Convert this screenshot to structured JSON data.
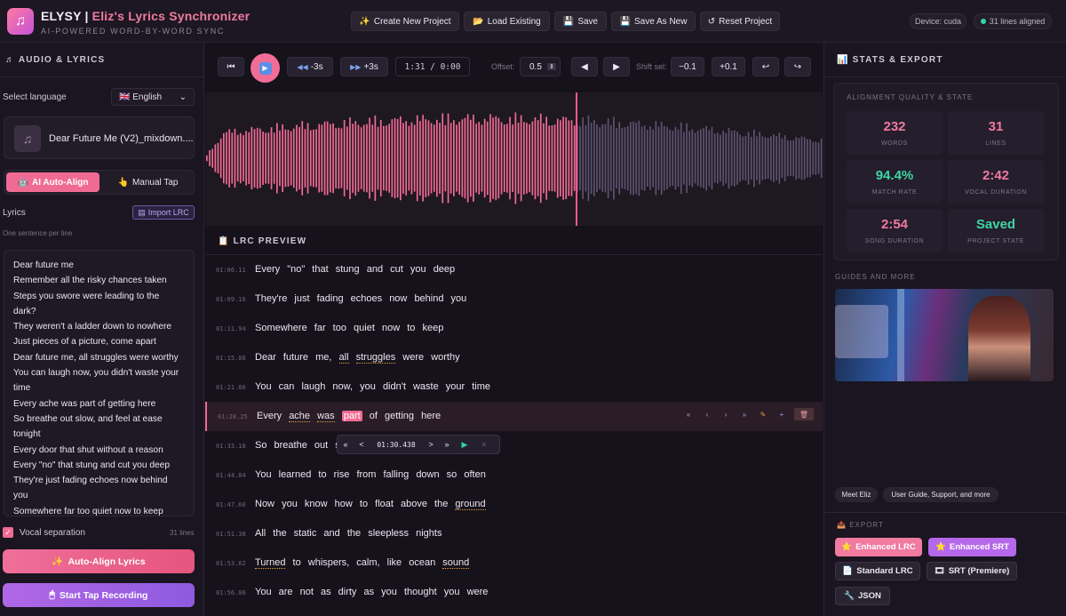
{
  "header": {
    "title": "ELYSY | Eliz's Lyrics Synchronizer",
    "subtitle": "AI-POWERED WORD-BY-WORD SYNC",
    "buttons": {
      "create": "Create New Project",
      "load": "Load Existing",
      "save": "Save",
      "save_as": "Save As New",
      "reset": "Reset Project"
    },
    "device": "Device: cuda",
    "aligned": "31 lines aligned"
  },
  "left": {
    "section_title": "AUDIO & LYRICS",
    "language_label": "Select language",
    "language_value": "🇬🇧 English",
    "file_name": "Dear Future Me (V2)_mixdown....",
    "mode_ai": "AI Auto-Align",
    "mode_manual": "Manual Tap",
    "lyrics_label": "Lyrics",
    "import_label": "Import LRC",
    "hint": "One sentence per line",
    "lyrics_lines": [
      "Dear future me",
      "Remember all the risky chances taken",
      "Steps you swore were leading to the",
      "dark?",
      "They weren't a ladder down to nowhere",
      "Just pieces of a picture, come apart",
      "Dear future me, all struggles were worthy",
      "You can laugh now, you didn't waste your",
      "time",
      "Every ache was part of getting here",
      "So breathe out slow, and feel at ease",
      "tonight",
      "Every door that shut without a reason",
      "Every \"no\" that stung and cut you deep",
      "They're just fading echoes now behind",
      "you",
      "Somewhere far too quiet now to keep"
    ],
    "vocal_sep_label": "Vocal separation",
    "line_count": "31 lines",
    "auto_align_button": "Auto-Align Lyrics",
    "tap_button": "Start Tap Recording"
  },
  "player": {
    "back_label": "-3s",
    "fwd_label": "+3s",
    "time": "1:31  /  0:00",
    "offset_label": "Offset:",
    "offset_value": "0.5",
    "shift_label": "Shift sel:",
    "minus": "−0.1",
    "plus": "+0.1"
  },
  "waveform": {
    "progress": 0.6,
    "played_color": "#f06b93",
    "remaining_color": "#5d5270"
  },
  "lrc": {
    "title": "LRC PREVIEW",
    "rows": [
      {
        "ts": "01:06.11",
        "text": "Every \"no\" that stung and cut you deep"
      },
      {
        "ts": "01:09.16",
        "text": "They're just fading echoes now behind you"
      },
      {
        "ts": "01:11.94",
        "text": "Somewhere far too quiet now to keep"
      },
      {
        "ts": "01:15.06",
        "text": "Dear future me, all struggles were worthy"
      },
      {
        "ts": "01:21.80",
        "text": "You can laugh now, you didn't waste your time"
      },
      {
        "ts": "01:28.25",
        "text": "Every ache was part of getting here"
      },
      {
        "ts": "01:33.18",
        "text": "So breathe out s"
      },
      {
        "ts": "01:44.84",
        "text": "You learned to rise from falling down so often"
      },
      {
        "ts": "01:47.60",
        "text": "Now you know how to float above the ground"
      },
      {
        "ts": "01:51.38",
        "text": "All the static and the sleepless nights"
      },
      {
        "ts": "01:53.62",
        "text": "Turned to whispers, calm, like ocean sound"
      },
      {
        "ts": "01:56.06",
        "text": "You are not as dirty as you thought you were"
      }
    ],
    "popup_time": "01:30.438"
  },
  "right": {
    "section_title": "STATS & EXPORT",
    "box_title": "ALIGNMENT QUALITY & STATE",
    "stats": [
      {
        "value": "232",
        "label": "WORDS",
        "color": "#f07aa0"
      },
      {
        "value": "31",
        "label": "LINES",
        "color": "#f07aa0"
      },
      {
        "value": "94.4%",
        "label": "MATCH RATE",
        "color": "#3ed6a6"
      },
      {
        "value": "2:42",
        "label": "VOCAL DURATION",
        "color": "#f07aa0"
      },
      {
        "value": "2:54",
        "label": "SONG DURATION",
        "color": "#f07aa0"
      },
      {
        "value": "Saved",
        "label": "PROJECT STATE",
        "color": "#3ed6a6"
      }
    ],
    "guides_title": "GUIDES AND MORE",
    "meet": "Meet Eliz",
    "guide": "User Guide, Support, and more",
    "export_title": "EXPORT",
    "exports": {
      "enh_lrc": "Enhanced LRC",
      "enh_srt": "Enhanced SRT",
      "std_lrc": "Standard LRC",
      "srt_prem": "SRT (Premiere)",
      "json": "JSON"
    }
  }
}
